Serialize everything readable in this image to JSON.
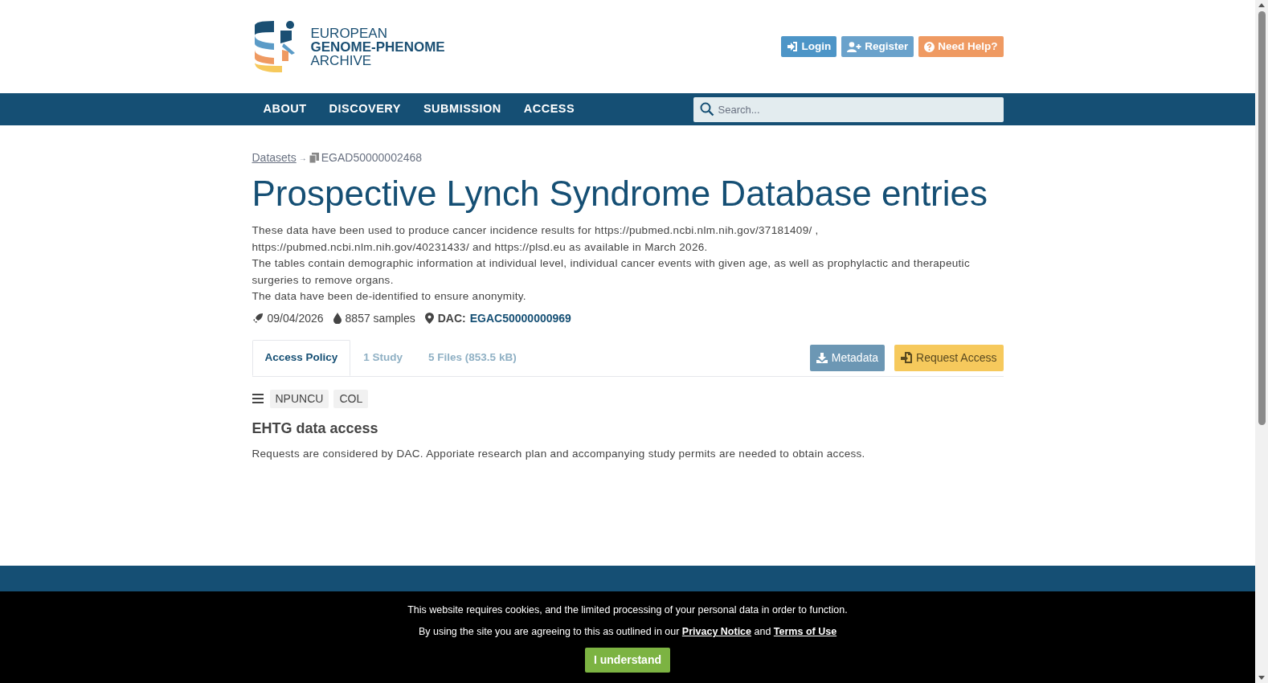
{
  "logo": {
    "lines": [
      "EUROPEAN",
      "GENOME-PHENOME",
      "ARCHIVE"
    ]
  },
  "header_buttons": [
    {
      "kind": "login",
      "label": "Login"
    },
    {
      "kind": "register",
      "label": "Register"
    },
    {
      "kind": "help",
      "label": "Need Help?"
    }
  ],
  "nav": {
    "items": [
      "ABOUT",
      "DISCOVERY",
      "SUBMISSION",
      "ACCESS"
    ],
    "search": {
      "placeholder": "Search..."
    }
  },
  "breadcrumb": {
    "parent": "Datasets",
    "separator": "→",
    "current": "EGAD50000002468"
  },
  "title": "Prospective Lynch Syndrome Database entries",
  "description": [
    "These data have been used to produce cancer incidence results for https://pubmed.ncbi.nlm.nih.gov/37181409/ , https://pubmed.ncbi.nlm.nih.gov/40231433/ and https://plsd.eu as available in March 2026.",
    "The tables contain demographic information at individual level, individual cancer events with given age, as well as prophylactic and therapeutic surgeries to remove organs.",
    "The data have been de-identified to ensure anonymity."
  ],
  "meta": {
    "date": "09/04/2026",
    "samples": "8857 samples",
    "dac_label": "DAC:",
    "dac_id": "EGAC50000000969"
  },
  "tabs": [
    {
      "label": "Access Policy",
      "selected": true
    },
    {
      "label": "1 Study",
      "selected": false
    },
    {
      "label": "5 Files (853.5 kB)",
      "selected": false
    }
  ],
  "actions": [
    {
      "kind": "metadata",
      "label": "Metadata"
    },
    {
      "kind": "request",
      "label": "Request Access"
    }
  ],
  "policy": {
    "tags": [
      "NPUNCU",
      "COL"
    ],
    "title": "EHTG data access",
    "text": "Requests are considered by DAC. Apporiate research plan and accompanying study permits are needed to obtain access."
  },
  "cookie_banner": {
    "line_1": "This website requires cookies, and the limited processing of your personal data in order to function.",
    "line_2_start": "By using the site you are agreeing to this as outlined in our",
    "links": [
      "Privacy Notice",
      "Terms of Use"
    ],
    "joiner": "and",
    "button": "I understand"
  }
}
